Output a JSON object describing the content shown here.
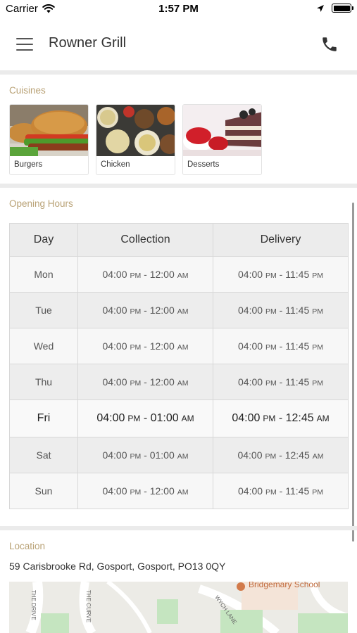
{
  "status_bar": {
    "carrier": "Carrier",
    "time": "1:57 PM"
  },
  "header": {
    "title": "Rowner Grill"
  },
  "cuisines": {
    "label": "Cuisines",
    "items": [
      {
        "name": "Burgers"
      },
      {
        "name": "Chicken"
      },
      {
        "name": "Desserts"
      }
    ]
  },
  "opening_hours": {
    "label": "Opening Hours",
    "columns": [
      "Day",
      "Collection",
      "Delivery"
    ],
    "rows": [
      {
        "day": "Mon",
        "collection": {
          "open": "04:00",
          "open_period": "PM",
          "close": "12:00",
          "close_period": "AM"
        },
        "delivery": {
          "open": "04:00",
          "open_period": "PM",
          "close": "11:45",
          "close_period": "PM"
        }
      },
      {
        "day": "Tue",
        "collection": {
          "open": "04:00",
          "open_period": "PM",
          "close": "12:00",
          "close_period": "AM"
        },
        "delivery": {
          "open": "04:00",
          "open_period": "PM",
          "close": "11:45",
          "close_period": "PM"
        }
      },
      {
        "day": "Wed",
        "collection": {
          "open": "04:00",
          "open_period": "PM",
          "close": "12:00",
          "close_period": "AM"
        },
        "delivery": {
          "open": "04:00",
          "open_period": "PM",
          "close": "11:45",
          "close_period": "PM"
        }
      },
      {
        "day": "Thu",
        "collection": {
          "open": "04:00",
          "open_period": "PM",
          "close": "12:00",
          "close_period": "AM"
        },
        "delivery": {
          "open": "04:00",
          "open_period": "PM",
          "close": "11:45",
          "close_period": "PM"
        }
      },
      {
        "day": "Fri",
        "collection": {
          "open": "04:00",
          "open_period": "PM",
          "close": "01:00",
          "close_period": "AM"
        },
        "delivery": {
          "open": "04:00",
          "open_period": "PM",
          "close": "12:45",
          "close_period": "AM"
        }
      },
      {
        "day": "Sat",
        "collection": {
          "open": "04:00",
          "open_period": "PM",
          "close": "01:00",
          "close_period": "AM"
        },
        "delivery": {
          "open": "04:00",
          "open_period": "PM",
          "close": "12:45",
          "close_period": "AM"
        }
      },
      {
        "day": "Sun",
        "collection": {
          "open": "04:00",
          "open_period": "PM",
          "close": "12:00",
          "close_period": "AM"
        },
        "delivery": {
          "open": "04:00",
          "open_period": "PM",
          "close": "11:45",
          "close_period": "PM"
        }
      }
    ]
  },
  "location": {
    "label": "Location",
    "address": "59 Carisbrooke Rd, Gosport, Gosport, PO13 0QY",
    "map_labels": {
      "school": "Bridgemary School",
      "road_1": "THE DRIVE",
      "road_2": "THE CURVE",
      "road_3": "WYCH LANE"
    }
  },
  "colors": {
    "section_label": "#b9a276",
    "divider": "#ebebeb",
    "table_header": "#ececec"
  },
  "icons": {
    "menu": "hamburger-icon",
    "call": "phone-icon",
    "wifi": "wifi-icon",
    "location": "location-arrow-icon",
    "battery": "battery-icon"
  }
}
